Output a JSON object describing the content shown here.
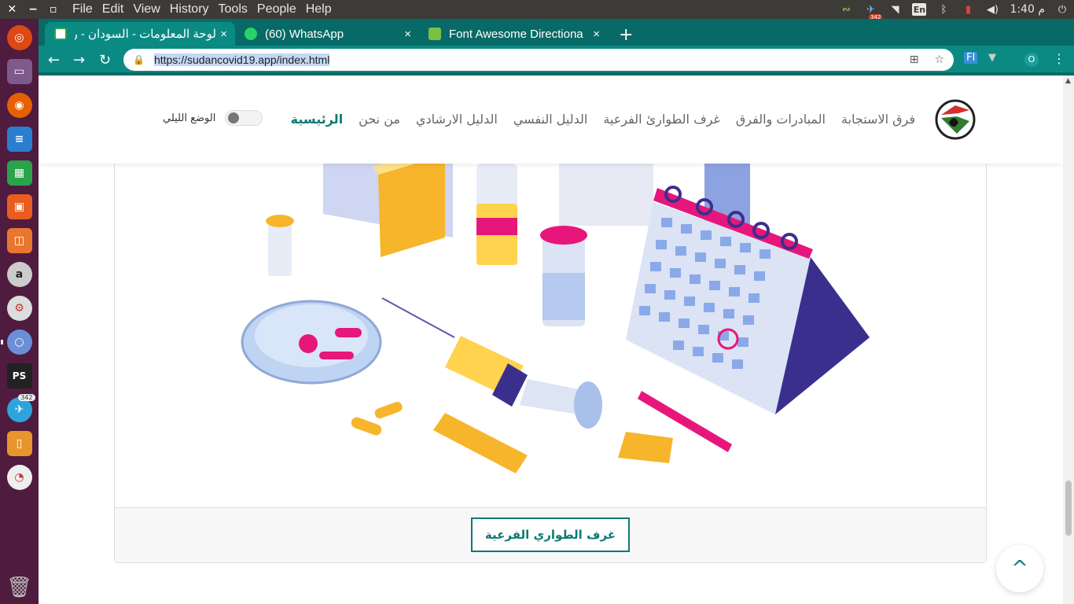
{
  "menubar": {
    "items": [
      "File",
      "Edit",
      "View",
      "History",
      "Tools",
      "People",
      "Help"
    ],
    "clock": "1:40 م",
    "keyboard": "En",
    "telegram_badge": "342"
  },
  "launcher": {
    "telegram_badge": "342",
    "icons": [
      "ubuntu-icon",
      "files-icon",
      "firefox-icon",
      "writer-icon",
      "calc-icon",
      "impress-icon",
      "software-icon",
      "amazon-icon",
      "settings-icon",
      "chrome-icon",
      "phpstorm-icon",
      "telegram-icon",
      "notes-icon",
      "disk-usage-icon"
    ]
  },
  "browser": {
    "tabs": [
      {
        "title": "لوحة المعلومات - السودان - ر",
        "close": "×"
      },
      {
        "title": "(60) WhatsApp",
        "close": "×"
      },
      {
        "title": "Font Awesome Directiona",
        "close": "×"
      }
    ],
    "new_tab": "+",
    "url": "https://sudancovid19.app/index.html",
    "profile_initial": "O"
  },
  "site": {
    "nav": [
      "الرئيسية",
      "من نحن",
      "الدليل الارشادي",
      "الدليل النفسي",
      "غرف الطوارئ الفرعية",
      "المبادرات والفرق",
      "فرق الاستجابة"
    ],
    "dark_mode_label": "الوضع الليلي",
    "card_button": "غرف الطواري الفرعية",
    "back_to_top": "^"
  },
  "colors": {
    "brand": "#0e7a73",
    "chrome_tab": "#086a66",
    "launcher": "#4f1b3f"
  }
}
